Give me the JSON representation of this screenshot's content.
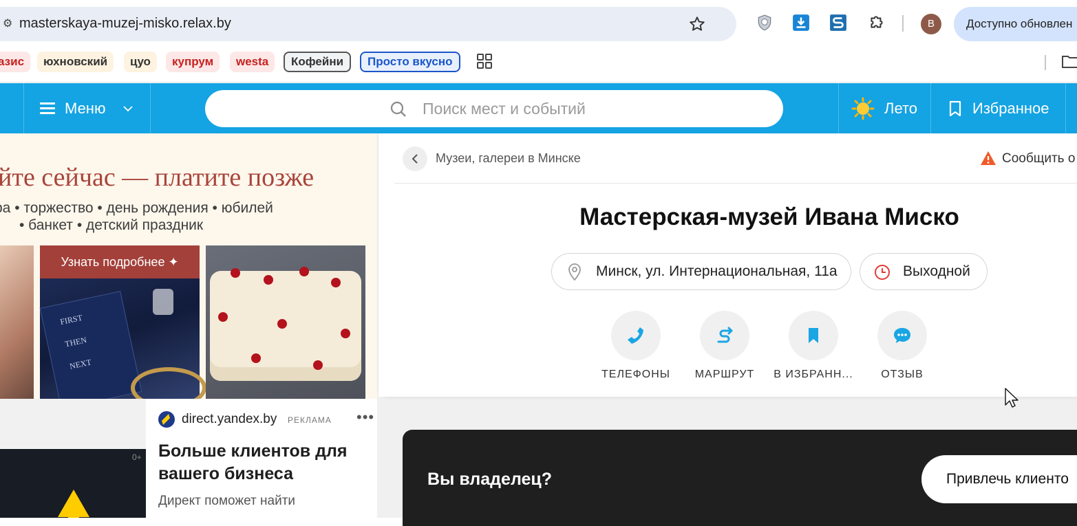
{
  "browser": {
    "url": "masterskaya-muzej-misko.relax.by",
    "update_label": "Доступно обновлен",
    "avatar_letter": "B",
    "bookmarks": [
      "азис",
      "юхновский",
      "цуо",
      "купрум",
      "westa",
      "Кофейни",
      "Просто вкусно"
    ]
  },
  "header": {
    "menu_label": "Меню",
    "search_placeholder": "Поиск мест и событий",
    "summer_label": "Лето",
    "favorites_label": "Избранное"
  },
  "ad_banner": {
    "headline": "уйте сейчас — платите позже",
    "line1": "ра • торжество • день рождения • юбилей",
    "line2": "• банкет • детский праздник",
    "cta": "Узнать подробнее ✦"
  },
  "yandex_ad": {
    "domain": "direct.yandex.by",
    "tag": "РЕКЛАМА",
    "more": "•••",
    "title": "Больше клиентов для вашего бизнеса",
    "description": "Директ поможет найти",
    "age": "0+"
  },
  "place": {
    "breadcrumb": "Музеи, галереи в Минске",
    "report_label": "Сообщить о",
    "title": "Мастерская-музей Ивана Миско",
    "address": "Минск, ул. Интернациональная, 11а",
    "hours": "Выходной",
    "actions": {
      "phones": "ТЕЛЕФОНЫ",
      "route": "МАРШРУТ",
      "favorite": "В ИЗБРАНН...",
      "review": "ОТЗЫВ"
    }
  },
  "owner": {
    "question": "Вы владелец?",
    "button": "Привлечь клиенто"
  },
  "colors": {
    "header_blue": "#14a3e3",
    "ad_red": "#a3403a",
    "accent_icon": "#1aa6e4",
    "owner_bg": "#1f1f1f"
  }
}
